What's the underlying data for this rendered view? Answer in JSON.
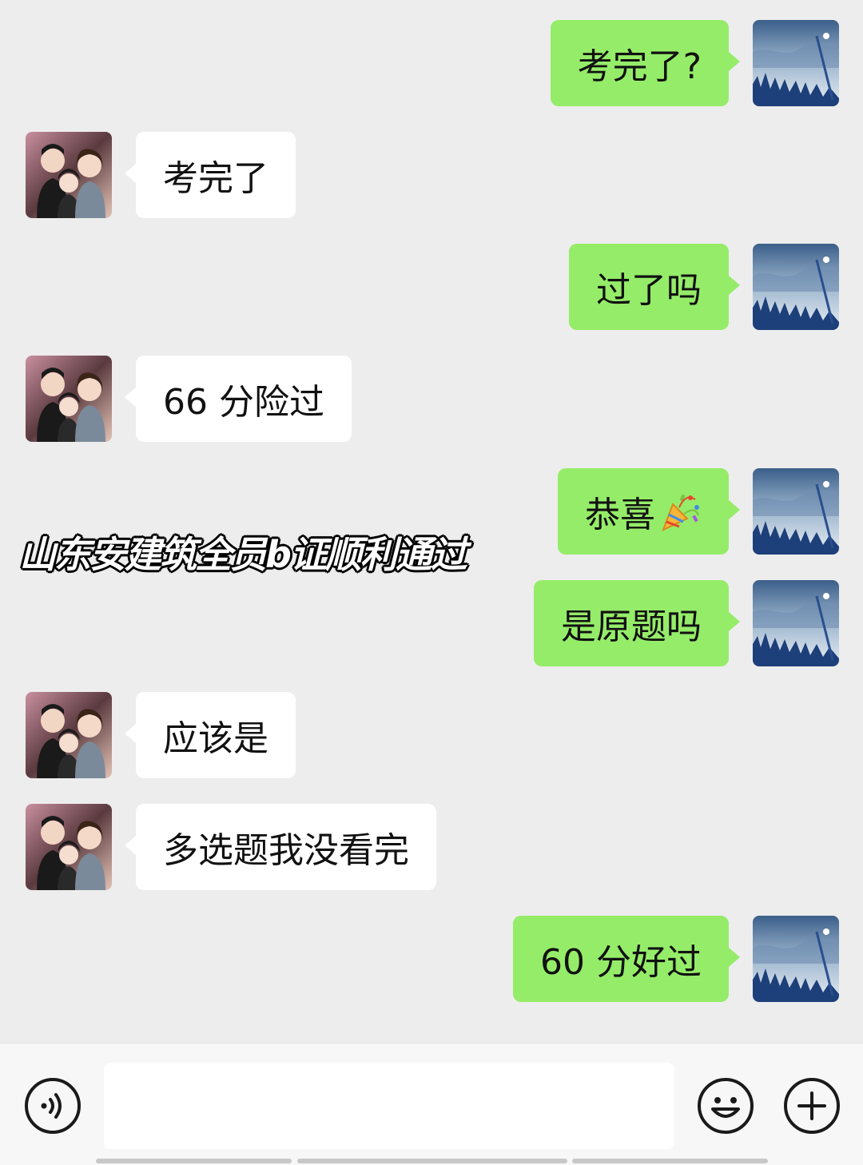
{
  "messages": [
    {
      "side": "out",
      "text": "考完了?"
    },
    {
      "side": "in",
      "text": "考完了"
    },
    {
      "side": "out",
      "text": "过了吗"
    },
    {
      "side": "in",
      "text": "66 分险过"
    },
    {
      "side": "out",
      "text": "恭喜",
      "emoji": "party-popper-icon"
    },
    {
      "side": "out",
      "text": "是原题吗"
    },
    {
      "side": "in",
      "text": "应该是"
    },
    {
      "side": "in",
      "text": "多选题我没看完"
    },
    {
      "side": "out",
      "text": "60 分好过"
    }
  ],
  "overlay_caption": "山东安建筑全员b证顺利通过",
  "input_bar": {
    "voice_icon": "voice-icon",
    "message_value": "",
    "emoji_icon": "emoji-icon",
    "plus_icon": "plus-icon"
  },
  "colors": {
    "background": "#ededed",
    "outgoing_bubble": "#95ec69",
    "incoming_bubble": "#ffffff"
  }
}
